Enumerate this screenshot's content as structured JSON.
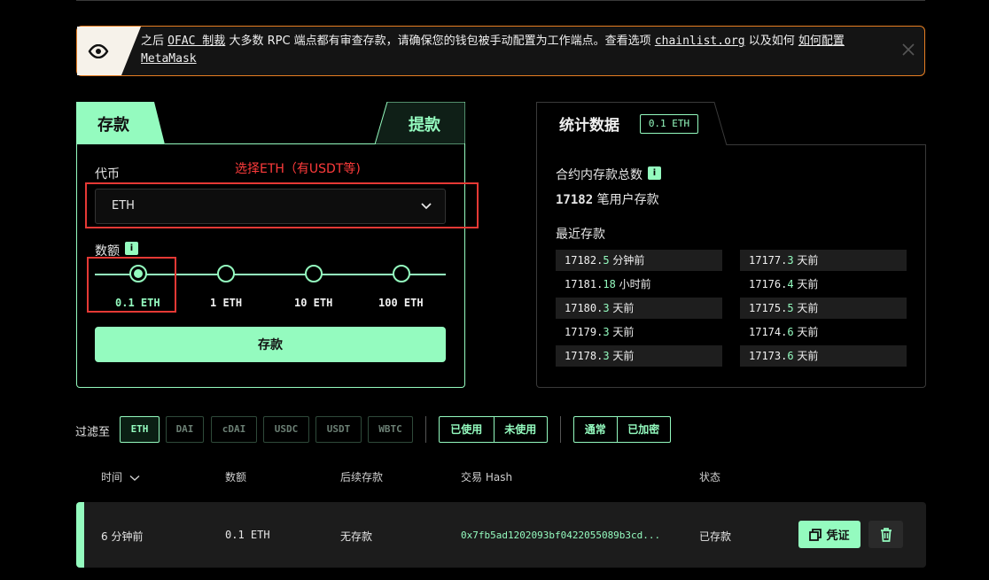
{
  "alert": {
    "p1": "之后",
    "link1": "OFAC 制裁",
    "p2": "大多数 RPC 端点都有审查存款，请确保您的钱包被手动配置为工作端点。查看选项",
    "link2": "chainlist.org",
    "p3": "以及如何",
    "link3": "如何配置 MetaMask"
  },
  "deposit": {
    "tab_deposit": "存款",
    "tab_withdraw": "提款",
    "token_label": "代币",
    "annotation": "选择ETH（有USDT等)",
    "token_value": "ETH",
    "amount_label": "数额",
    "info_glyph": "i",
    "stops": [
      "0.1 ETH",
      "1 ETH",
      "10 ETH",
      "100 ETH"
    ],
    "selected_stop": 0,
    "submit": "存款"
  },
  "stats": {
    "title": "统计数据",
    "badge": "0.1 ETH",
    "total_label": "合约内存款总数",
    "total_count": "17182",
    "total_suffix": "笔用户存款",
    "recent_label": "最近存款",
    "recent": [
      {
        "idx": "17182.",
        "num": "5",
        "unit": "分钟前"
      },
      {
        "idx": "17177.",
        "num": "3",
        "unit": "天前"
      },
      {
        "idx": "17181.",
        "num": "18",
        "unit": "小时前"
      },
      {
        "idx": "17176.",
        "num": "4",
        "unit": "天前"
      },
      {
        "idx": "17180.",
        "num": "3",
        "unit": "天前"
      },
      {
        "idx": "17175.",
        "num": "5",
        "unit": "天前"
      },
      {
        "idx": "17179.",
        "num": "3",
        "unit": "天前"
      },
      {
        "idx": "17174.",
        "num": "6",
        "unit": "天前"
      },
      {
        "idx": "17178.",
        "num": "3",
        "unit": "天前"
      },
      {
        "idx": "17173.",
        "num": "6",
        "unit": "天前"
      }
    ]
  },
  "filters": {
    "label": "过滤至",
    "tokens": [
      "ETH",
      "DAI",
      "cDAI",
      "USDC",
      "USDT",
      "WBTC"
    ],
    "status": [
      "已使用",
      "未使用"
    ],
    "privacy": [
      "通常",
      "已加密"
    ]
  },
  "table": {
    "headers": [
      "时间",
      "数额",
      "后续存款",
      "交易 Hash",
      "状态"
    ],
    "row": {
      "time": "6 分钟前",
      "amount": "0.1 ETH",
      "subsequent": "无存款",
      "hash": "0x7fb5ad1202093bf0422055089b3cd...",
      "status": "已存款",
      "proof": "凭证"
    }
  },
  "colors": {
    "accent": "#94fbbf",
    "alert_border": "#e67e22",
    "annotation": "#ff3b3b"
  }
}
